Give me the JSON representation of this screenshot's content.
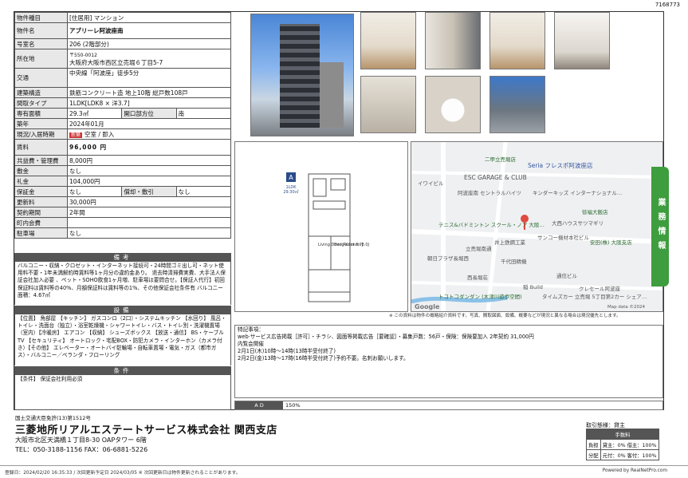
{
  "doc_id": "7168773",
  "property": {
    "type_label": "物件種目",
    "type_value": "[住居用] マンション",
    "name_label": "物件名",
    "name_value": "アブリーレ阿波座南",
    "room_label": "号室名",
    "room_value": "206 (2階部分)",
    "addr_label": "所在地",
    "addr_zip": "〒550-0012",
    "addr_value": "大阪府大阪市西区立売堀６丁目5-7",
    "access_label": "交通",
    "access_value": "中央線「阿波座」徒歩5分",
    "struct_label": "建築構造",
    "struct_value": "鉄筋コンクリート造 地上10階 総戸数108戸",
    "layout_label": "間取タイプ",
    "layout_value": "1LDK[LDK8 × 洋3.7]",
    "area_label": "専有面積",
    "area_value": "29.3㎡",
    "facing_label": "開口部方位",
    "facing_value": "南",
    "built_label": "築年",
    "built_value": "2024年01月",
    "status_label": "現況/入居時期",
    "status_badge": "新築",
    "status_value": "空室 / 即入",
    "rent_label": "賃料",
    "rent_value": "96,000 円",
    "mgmt_label": "共益費・管理費",
    "mgmt_value": "8,000円",
    "deposit_label": "敷金",
    "deposit_value": "なし",
    "key_label": "礼金",
    "key_value": "104,000円",
    "guarantee_label": "保証金",
    "guarantee_value": "なし",
    "amort_label": "償却・敷引",
    "amort_value": "なし",
    "renew_label": "更新料",
    "renew_value": "30,000円",
    "contract_label": "契約期間",
    "contract_value": "2年間",
    "town_label": "町内会費",
    "town_value": "",
    "parking_label": "駐車場",
    "parking_value": "なし"
  },
  "remarks": {
    "title": "備考",
    "text": "バルコニー・収納・クロゼット・インターネット接続可・24時間ゴミ出し可・ネット使用料不要・1年未満解約時賃料等1ヶ月分の違約金あり。 退去時清掃費実費、大手法人保証会社加入必要 、ペット・SOHO飲食1ヶ月増、駐車場は要問合せ。【保証人代行】初回保証料は賃料等の40%、月額保証料は賃料等の1%、その他保証会社条件有 バルコニー面積：4.67㎡"
  },
  "equipment": {
    "title": "設備",
    "text": "【位置】 角部屋 【キッチン】 ガスコンロ（2口）・システムキッチン 【水回り】 風呂・トイレ・洗面台（独立）・浴室乾燥機・シャワートイレ・バス・トイレ別・洗濯機置場（室内）【冷暖房】 エアコン 【収納】 シューズボックス 【放送・通信】 BS・ケーブルTV 【セキュリティ】 オートロック・宅配BOX・防犯カメラ・インターホン（カメラ付き）【その他】 エレベーター・オートバイ駐輪場・自転車置場・電気・ガス（都市ガス）・バルコニー／ベランダ・フローリング"
  },
  "conditions": {
    "title": "条件",
    "text": "【条件】 保証会社利用必須"
  },
  "floorplan": {
    "label_a": "A",
    "label_type": "1LDK",
    "label_area": "29.30㎡",
    "room_ldk": "Living Dining Kitchen 8.0J",
    "room_bed": "Bed Room 3.7J"
  },
  "map": {
    "labels": [
      "二甲立売堀店",
      "Seria フレスポ阿波座店",
      "ESC GARAGE & CLUB",
      "イワイビル",
      "キンダーキッズ インターナショナル…",
      "阿波座南 セントラルハイツ",
      "徐福大飯店",
      "テニス&バドミントン スクール・ノア 大阪…",
      "大西ハウスサツマギリ",
      "サンコー機材本社ビル",
      "井上鉄鋼工業",
      "安田(株) 大阪支店",
      "朝日プラザ長堀西",
      "千代田精機",
      "西長堀荘",
      "通信ビル",
      "クレセール阿波座",
      "稲 Build",
      "トコトコダンダン (木津川遊歩空間)",
      "タイムズカー 立売堀 5丁目第2カー シェア…",
      "立売堀南通",
      "Map data ©2024"
    ],
    "google": "Google"
  },
  "disclaimer": "※ この資料は物件の概略紹介資料です。写真、間取図面、設備、概要などが現況と異なる場合は現況優先とします。",
  "notes": {
    "title": "特記事項：",
    "lines": [
      "web·サービス広告掲載［許可］・チラシ、図面等掲載広告［要確認］・募集戸数：56戸・保険：保険要加入 2年契約 31,000円",
      "内覧会開催",
      "2月1日(木)10時～14時(13時半受付終了)",
      "2月2日(金)13時～17時(16時半受付終了)予約不要。名刺お願いします。"
    ]
  },
  "ad": {
    "label": "A D",
    "value": "150%"
  },
  "tab_text": "業務情報",
  "footer": {
    "license": "国土交通大臣免許(13)第1512号",
    "company": "三菱地所リアルエステートサービス株式会社 関西支店",
    "address": "大阪市北区天満橋１丁目8-30 OAPタワー 6階",
    "tel": "TEL：050-3188-1156 FAX：06-6881-5226",
    "fee_title": "取引態様：貸主",
    "fee_header": "手数料",
    "fee_row1_k": "負担",
    "fee_row1_v": "貸主：0% 借主：100%",
    "fee_row2_k": "分配",
    "fee_row2_v": "元付：0% 客付：100%"
  },
  "bottom": {
    "left": "登録日：2024/02/20 16:35:33 / 次回更新予定日 2024/03/05 ※ 次回更新日は物件更新されることがあります。",
    "right": "Powered by RealNetPro.com"
  }
}
